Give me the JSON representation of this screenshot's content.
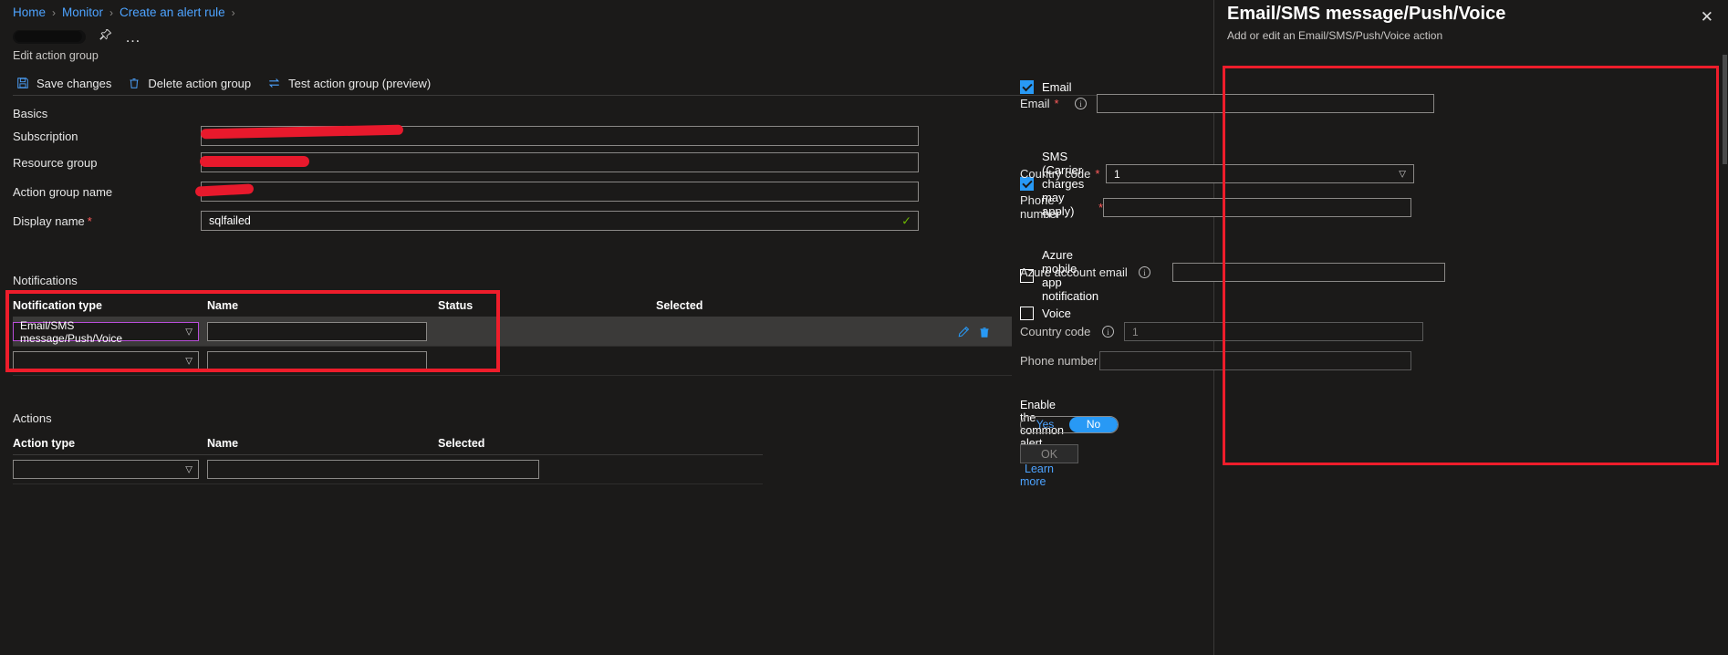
{
  "breadcrumb": {
    "items": [
      "Home",
      "Monitor",
      "Create an alert rule"
    ],
    "separator": "›"
  },
  "header": {
    "subtitle": "Edit action group",
    "pin_icon": "pin-icon",
    "more_icon": "…"
  },
  "commandbar": {
    "save": "Save changes",
    "delete": "Delete action group",
    "test": "Test action group (preview)"
  },
  "basics": {
    "section_label": "Basics",
    "subscription_label": "Subscription",
    "subscription_value": "",
    "resource_group_label": "Resource group",
    "resource_group_value": "",
    "action_group_name_label": "Action group name",
    "action_group_name_value": "",
    "display_name_label": "Display name",
    "display_name_required": "*",
    "display_name_value": "sqlfailed",
    "valid_check": "✓"
  },
  "notifications": {
    "section_label": "Notifications",
    "columns": [
      "Notification type",
      "Name",
      "Status",
      "Selected"
    ],
    "rows": [
      {
        "type": "Email/SMS message/Push/Voice",
        "name": "",
        "status": "",
        "selected": "",
        "edit_icon": "pencil-icon",
        "delete_icon": "trash-icon"
      },
      {
        "type": "",
        "name": "",
        "status": "",
        "selected": ""
      }
    ]
  },
  "actions": {
    "section_label": "Actions",
    "columns": [
      "Action type",
      "Name",
      "Selected"
    ],
    "rows": [
      {
        "type": "",
        "name": "",
        "selected": ""
      }
    ]
  },
  "panel": {
    "title": "Email/SMS message/Push/Voice",
    "subtitle": "Add or edit an Email/SMS/Push/Voice action",
    "close_icon": "✕",
    "email": {
      "checkbox_label": "Email",
      "checked": true,
      "field_label": "Email",
      "required": "*",
      "value": ""
    },
    "sms": {
      "checkbox_label": "SMS (Carrier charges may apply)",
      "checked": true,
      "country_code_label": "Country code",
      "country_code_required": "*",
      "country_code_value": "1",
      "phone_label": "Phone number",
      "phone_required": "*",
      "phone_value": ""
    },
    "mobile_app": {
      "checkbox_label": "Azure mobile app notification",
      "checked": false,
      "account_email_label": "Azure account email",
      "account_email_value": ""
    },
    "voice": {
      "checkbox_label": "Voice",
      "checked": false,
      "country_code_label": "Country code",
      "country_code_value": "1",
      "phone_label": "Phone number",
      "phone_value": ""
    },
    "schema": {
      "text": "Enable the common alert schema.",
      "link": "Learn more",
      "yes_label": "Yes",
      "no_label": "No",
      "selected": "No"
    },
    "ok_label": "OK"
  },
  "colors": {
    "accent": "#2899f5",
    "link": "#4da3ff",
    "highlight": "#ee1d2b",
    "focus": "#b84dd9",
    "valid": "#6bb700",
    "background": "#1b1a19"
  }
}
